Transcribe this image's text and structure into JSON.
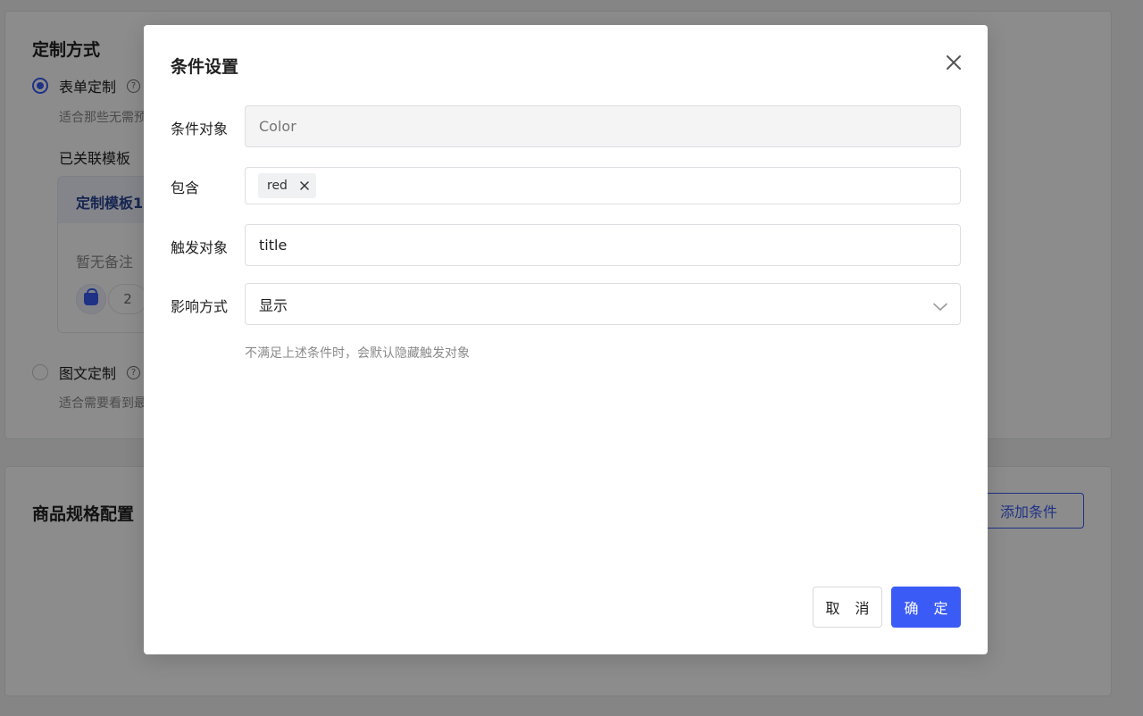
{
  "background": {
    "customization": {
      "title": "定制方式",
      "form_option": {
        "label": "表单定制",
        "hint": "适合那些无需预",
        "selected": true
      },
      "linked_template_label": "已关联模板",
      "template": {
        "name": "定制模板1",
        "remark": "暂无备注",
        "count": "2"
      },
      "graphic_option": {
        "label": "图文定制",
        "hint": "适合需要看到最",
        "selected": false
      }
    },
    "spec_config": {
      "title": "商品规格配置",
      "add_condition_label": "添加条件"
    }
  },
  "modal": {
    "title": "条件设置",
    "fields": {
      "condition_object": {
        "label": "条件对象",
        "placeholder": "Color"
      },
      "contains": {
        "label": "包含",
        "tags": [
          "red"
        ]
      },
      "trigger_object": {
        "label": "触发对象",
        "value": "title"
      },
      "effect_mode": {
        "label": "影响方式",
        "value": "显示"
      }
    },
    "hint": "不满足上述条件时，会默认隐藏触发对象",
    "cancel_label": "取 消",
    "ok_label": "确 定"
  },
  "colors": {
    "primary": "#3a5bf5",
    "mask": "rgba(0,0,0,0.45)"
  }
}
